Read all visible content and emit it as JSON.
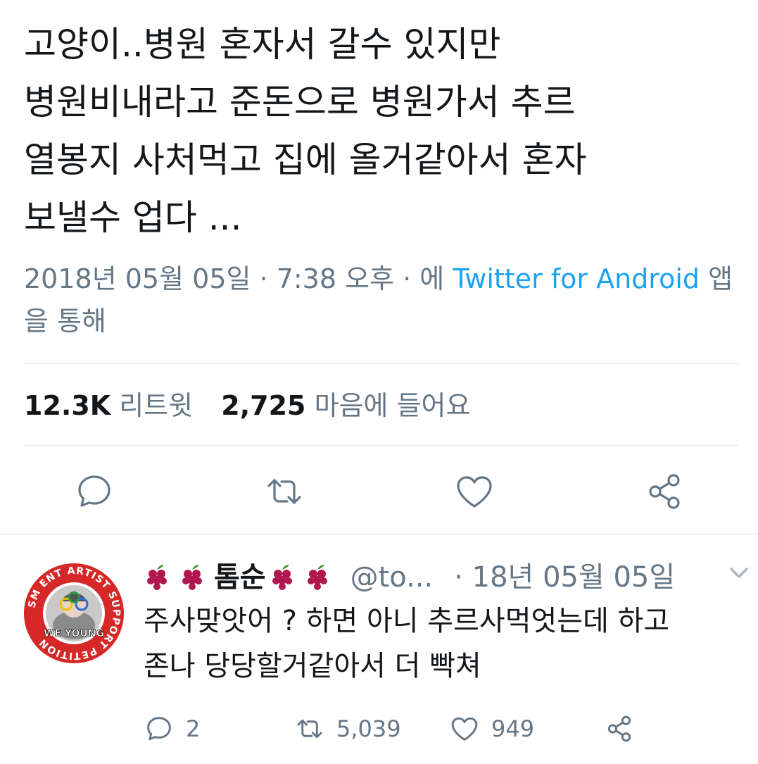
{
  "tweet": {
    "text": "고양이..병원 혼자서 갈수 있지만\n병원비내라고 준돈으로 병원가서 추르\n열봉지 사처먹고 집에 올거같아서 혼자\n보낼수 업다 ...",
    "date": "2018년 05월 05일",
    "sep1": " · ",
    "time": "7:38 오후",
    "sep2": " · ",
    "via_prefix": "에 ",
    "client": "Twitter for Android",
    "via_suffix": " 앱을 통해"
  },
  "stats": {
    "retweets_count": "12.3K",
    "retweets_label": "리트윗",
    "likes_count": "2,725",
    "likes_label": "마음에 들어요"
  },
  "actions": {
    "icons": [
      "reply-icon",
      "retweet-icon",
      "like-icon",
      "share-icon"
    ]
  },
  "reply": {
    "name": "톰순",
    "handle": "@to...",
    "dot": "·",
    "date": "18년 05월 05일",
    "text": "주사맞앗어 ? 하면 아니 추르사먹엇는데 하고\n존나 당당할거같아서 더 빡쳐",
    "avatar_ring_text": "SM ENT ARTIST SUPPORT PETITION",
    "avatar_caption": "WE YOUNG",
    "reply_count": "2",
    "retweet_count": "5,039",
    "like_count": "949"
  },
  "colors": {
    "text": "#14171a",
    "secondary": "#657786",
    "link": "#1da1f2",
    "divider": "#e1e8ed",
    "avatar_red": "#d62828",
    "grape": "#b0174e"
  }
}
